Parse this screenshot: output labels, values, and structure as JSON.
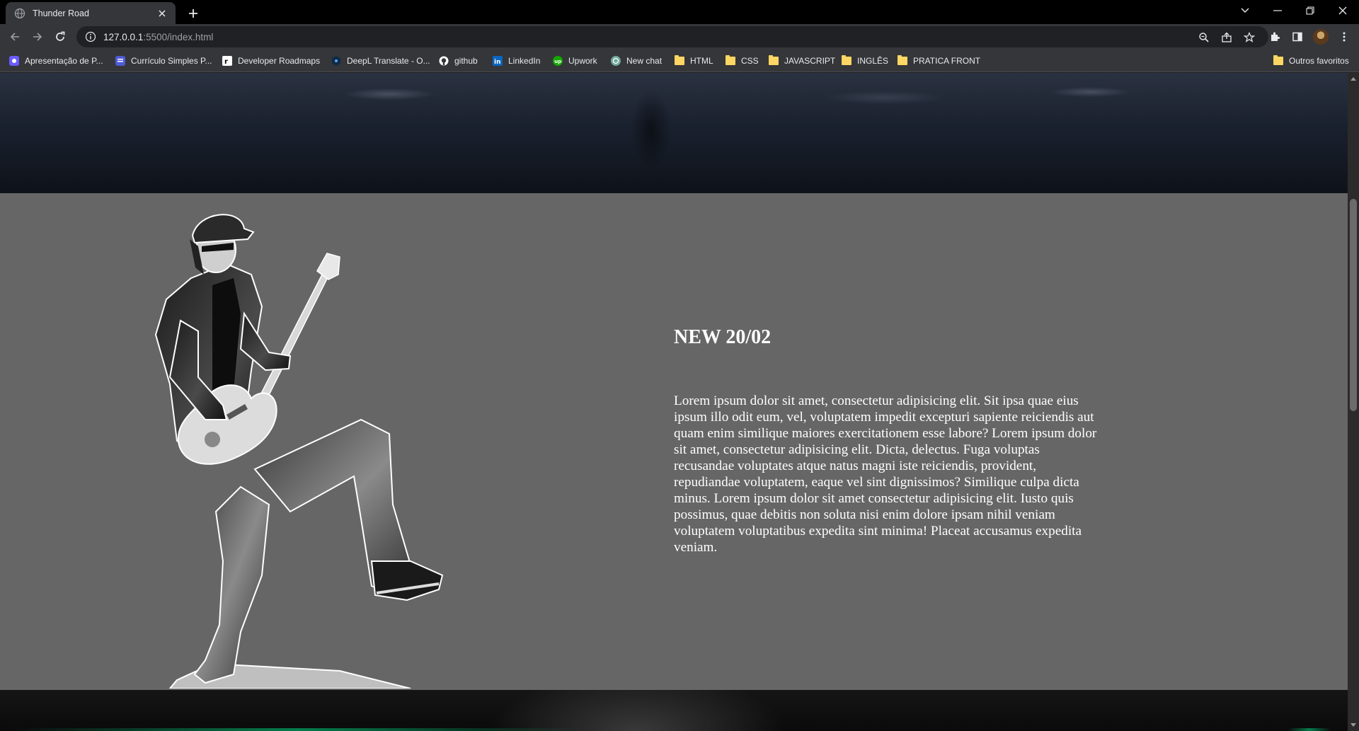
{
  "browser": {
    "tab": {
      "title": "Thunder Road"
    },
    "url": {
      "host": "127.0.0.1",
      "path": ":5500/index.html"
    },
    "bookmarks": [
      {
        "label": "Apresentação de P...",
        "icon": "app-icon"
      },
      {
        "label": "Currículo Simples P...",
        "icon": "doc-icon"
      },
      {
        "label": "Developer Roadmaps",
        "icon": "roadmap-icon"
      },
      {
        "label": "DeepL Translate - O...",
        "icon": "deepl-icon"
      },
      {
        "label": "github",
        "icon": "github-icon"
      },
      {
        "label": "LinkedIn",
        "icon": "linkedin-icon"
      },
      {
        "label": "Upwork",
        "icon": "upwork-icon"
      },
      {
        "label": "New chat",
        "icon": "chat-icon"
      },
      {
        "label": "HTML",
        "icon": "folder-icon"
      },
      {
        "label": "CSS",
        "icon": "folder-icon"
      },
      {
        "label": "JAVASCRIPT",
        "icon": "folder-icon"
      },
      {
        "label": "INGLÊS",
        "icon": "folder-icon"
      },
      {
        "label": "PRATICA FRONT",
        "icon": "folder-icon"
      }
    ],
    "other_bookmarks": "Outros favoritos"
  },
  "page": {
    "news": {
      "title": "NEW 20/02",
      "body": "Lorem ipsum dolor sit amet, consectetur adipisicing elit. Sit ipsa quae eius ipsum illo odit eum, vel, voluptatem impedit excepturi sapiente reiciendis aut quam enim similique maiores exercitationem esse labore? Lorem ipsum dolor sit amet, consectetur adipisicing elit. Dicta, delectus. Fuga voluptas recusandae voluptates atque natus magni iste reiciendis, provident, repudiandae voluptatem, eaque vel sint dignissimos? Similique culpa dicta minus. Lorem ipsum dolor sit amet consectetur adipisicing elit. Iusto quis possimus, quae debitis non soluta nisi enim dolore ipsam nihil veniam voluptatem voluptatibus expedita sint minima! Placeat accusamus expedita veniam."
    }
  },
  "colors": {
    "section_bg": "#666666",
    "chrome_dark": "#000000",
    "chrome_toolbar": "#35363a",
    "text_light": "#ffffff"
  }
}
